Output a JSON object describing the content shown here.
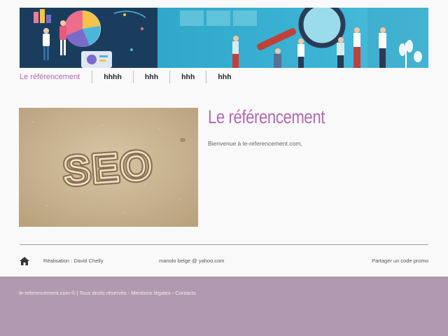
{
  "nav": {
    "items": [
      {
        "label": "Le référencement"
      },
      {
        "label": "hhhh"
      },
      {
        "label": "hhh"
      },
      {
        "label": "hhh"
      },
      {
        "label": "hhh"
      }
    ]
  },
  "main": {
    "title": "Le référencement",
    "intro": "Bienvenue à le-referencement.com,",
    "image_text": "SEO"
  },
  "footer": {
    "realisation": "Réalisation : David Chelly",
    "email": "manolo belge @ yahoo.com",
    "share": "Partager un code promo",
    "copyright": "le-referencement.com © | Tous droits réservés - Mentions légales - Contacts"
  },
  "colors": {
    "accent": "#b46ab3",
    "bottom_bar": "#b19aaf"
  }
}
